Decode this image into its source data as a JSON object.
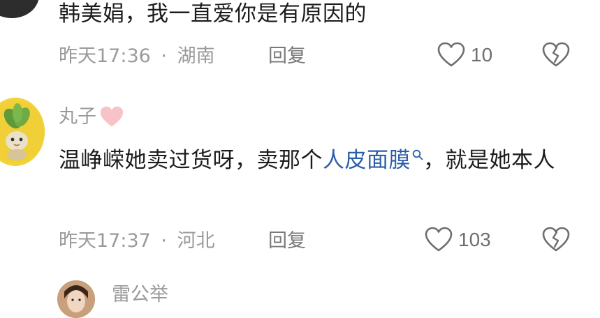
{
  "comments": [
    {
      "text": "韩美娟，我一直爱你是有原因的",
      "time": "昨天17:36",
      "separator": "·",
      "location": "湖南",
      "reply_label": "回复",
      "likes": "10"
    },
    {
      "username": "丸子",
      "text_before_link": "温峥嵘她卖过货呀，卖那个",
      "link_text": "人皮面膜",
      "text_after_link": "，就是她本人",
      "time": "昨天17:37",
      "separator": "·",
      "location": "河北",
      "reply_label": "回复",
      "likes": "103"
    },
    {
      "username": "雷公举"
    }
  ],
  "icons": {
    "like": "heart-outline-icon",
    "dislike": "broken-heart-icon",
    "search": "search-icon",
    "badge": "pink-heart-icon"
  },
  "colors": {
    "text": "#1c1c1c",
    "meta": "#9a9a9a",
    "link": "#2b5ea8",
    "badge": "#f7c3c8"
  }
}
